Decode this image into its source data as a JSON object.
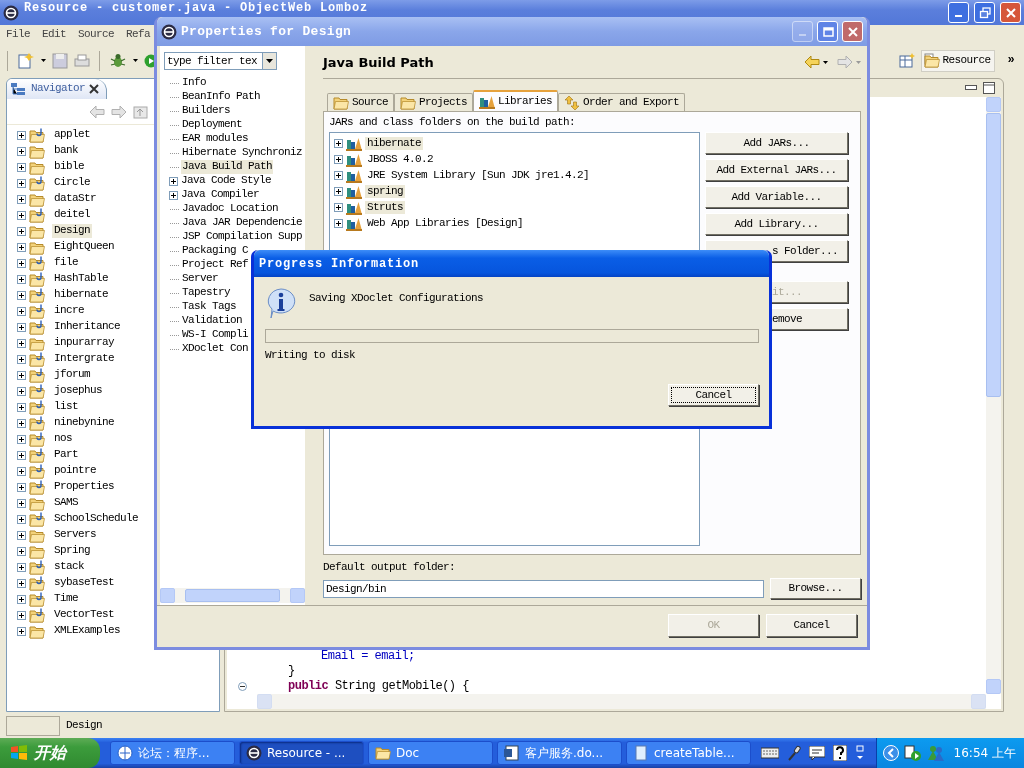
{
  "main_window": {
    "title": "Resource - customer.java - ObjectWeb Lomboz",
    "menu": [
      "File",
      "Edit",
      "Source",
      "Refa"
    ],
    "perspective": {
      "label": "Resource",
      "more": "»"
    },
    "navigator": {
      "title": "Navigator",
      "items": [
        {
          "label": "applet",
          "kind": "java",
          "selected": false
        },
        {
          "label": "bank",
          "kind": "plain",
          "selected": false
        },
        {
          "label": "bible",
          "kind": "plain",
          "selected": false
        },
        {
          "label": "Circle",
          "kind": "java",
          "selected": false
        },
        {
          "label": "dataStr",
          "kind": "plain",
          "selected": false
        },
        {
          "label": "deitel",
          "kind": "java",
          "selected": false
        },
        {
          "label": "Design",
          "kind": "plain",
          "selected": true
        },
        {
          "label": "EightQueen",
          "kind": "plain",
          "selected": false
        },
        {
          "label": "file",
          "kind": "java",
          "selected": false
        },
        {
          "label": "HashTable",
          "kind": "java",
          "selected": false
        },
        {
          "label": "hibernate",
          "kind": "java",
          "selected": false
        },
        {
          "label": "incre",
          "kind": "java",
          "selected": false
        },
        {
          "label": "Inheritance",
          "kind": "java",
          "selected": false
        },
        {
          "label": "inpurarray",
          "kind": "plain",
          "selected": false
        },
        {
          "label": "Intergrate",
          "kind": "java",
          "selected": false
        },
        {
          "label": "jforum",
          "kind": "java",
          "selected": false
        },
        {
          "label": "josephus",
          "kind": "java",
          "selected": false
        },
        {
          "label": "list",
          "kind": "java",
          "selected": false
        },
        {
          "label": "ninebynine",
          "kind": "java",
          "selected": false
        },
        {
          "label": "nos",
          "kind": "java",
          "selected": false
        },
        {
          "label": "Part",
          "kind": "java",
          "selected": false
        },
        {
          "label": "pointre",
          "kind": "java",
          "selected": false
        },
        {
          "label": "Properties",
          "kind": "java",
          "selected": false
        },
        {
          "label": "SAMS",
          "kind": "plain",
          "selected": false
        },
        {
          "label": "SchoolSchedule",
          "kind": "java",
          "selected": false
        },
        {
          "label": "Servers",
          "kind": "plain",
          "selected": false
        },
        {
          "label": "Spring",
          "kind": "plain",
          "selected": false
        },
        {
          "label": "stack",
          "kind": "java",
          "selected": false
        },
        {
          "label": "sybaseTest",
          "kind": "java",
          "selected": false
        },
        {
          "label": "Time",
          "kind": "java",
          "selected": false
        },
        {
          "label": "VectorTest",
          "kind": "java",
          "selected": false
        },
        {
          "label": "XMLExamples",
          "kind": "plain",
          "selected": false
        }
      ]
    },
    "editor": {
      "lines": [
        "Email = email;",
        "}",
        "**public** String getMobile() {"
      ]
    },
    "status_bar": "Design"
  },
  "properties_dialog": {
    "title": "Properties for Design",
    "filter": {
      "value": "type filter tex"
    },
    "tree": [
      {
        "label": "Info",
        "expandable": false,
        "selected": false
      },
      {
        "label": "BeanInfo Path",
        "expandable": false,
        "selected": false
      },
      {
        "label": "Builders",
        "expandable": false,
        "selected": false
      },
      {
        "label": "Deployment",
        "expandable": false,
        "selected": false
      },
      {
        "label": "EAR modules",
        "expandable": false,
        "selected": false
      },
      {
        "label": "Hibernate Synchroniz",
        "expandable": false,
        "selected": false
      },
      {
        "label": "Java Build Path",
        "expandable": false,
        "selected": true
      },
      {
        "label": "Java Code Style",
        "expandable": true,
        "selected": false
      },
      {
        "label": "Java Compiler",
        "expandable": true,
        "selected": false
      },
      {
        "label": "Javadoc Location",
        "expandable": false,
        "selected": false
      },
      {
        "label": "Java JAR Dependencie",
        "expandable": false,
        "selected": false
      },
      {
        "label": "JSP Compilation Supp",
        "expandable": false,
        "selected": false
      },
      {
        "label": "Packaging C",
        "expandable": false,
        "selected": false
      },
      {
        "label": "Project Ref",
        "expandable": false,
        "selected": false
      },
      {
        "label": "Server",
        "expandable": false,
        "selected": false
      },
      {
        "label": "Tapestry",
        "expandable": false,
        "selected": false
      },
      {
        "label": "Task Tags",
        "expandable": false,
        "selected": false
      },
      {
        "label": "Validation",
        "expandable": false,
        "selected": false
      },
      {
        "label": "WS-I Compli",
        "expandable": false,
        "selected": false
      },
      {
        "label": "XDoclet Con",
        "expandable": false,
        "selected": false
      }
    ],
    "page_title": "Java Build Path",
    "tabs": [
      {
        "label": "Source",
        "kind": "source",
        "selected": false
      },
      {
        "label": "Projects",
        "kind": "projects",
        "selected": false
      },
      {
        "label": "Libraries",
        "kind": "libraries",
        "selected": true
      },
      {
        "label": "Order and Export",
        "kind": "order",
        "selected": false
      }
    ],
    "list_label": "JARs and class folders on the build path:",
    "libraries": [
      {
        "label": "hibernate",
        "highlighted": true
      },
      {
        "label": "JBOSS 4.0.2",
        "highlighted": false
      },
      {
        "label": "JRE System Library [Sun JDK jre1.4.2]",
        "highlighted": false
      },
      {
        "label": "spring",
        "highlighted": true
      },
      {
        "label": "Struts",
        "highlighted": true
      },
      {
        "label": "Web App Libraries [Design]",
        "highlighted": false
      }
    ],
    "buttons": [
      {
        "label": "Add JARs...",
        "kind": "full",
        "disabled": false
      },
      {
        "label": "Add External JARs...",
        "kind": "full",
        "disabled": false
      },
      {
        "label": "Add Variable...",
        "kind": "full",
        "disabled": false
      },
      {
        "label": "Add Library...",
        "kind": "full",
        "disabled": false
      },
      {
        "label": "s Folder...",
        "kind": "covered",
        "disabled": false
      },
      {
        "label": "it...",
        "kind": "covered",
        "disabled": true
      },
      {
        "label": "emove",
        "kind": "covered",
        "disabled": false
      }
    ],
    "output_label": "Default output folder:",
    "output_value": "Design/bin",
    "browse": "Browse...",
    "ok": {
      "label": "OK",
      "disabled": true
    },
    "cancel": "Cancel"
  },
  "progress_dialog": {
    "title": "Progress Information",
    "message": "Saving XDoclet Configurations",
    "level": 0,
    "detail": "Writing to disk",
    "cancel": "Cancel"
  },
  "taskbar": {
    "start": "开始",
    "tasks": [
      {
        "label": "论坛：程序...",
        "kind": "browser",
        "selected": false
      },
      {
        "label": "Resource - ...",
        "kind": "eclipse",
        "selected": true
      },
      {
        "label": "Doc",
        "kind": "folder",
        "selected": false
      },
      {
        "label": "客户服务.do...",
        "kind": "word",
        "selected": false
      },
      {
        "label": "createTable...",
        "kind": "file",
        "selected": false
      }
    ],
    "clock": "16:54 上午"
  }
}
